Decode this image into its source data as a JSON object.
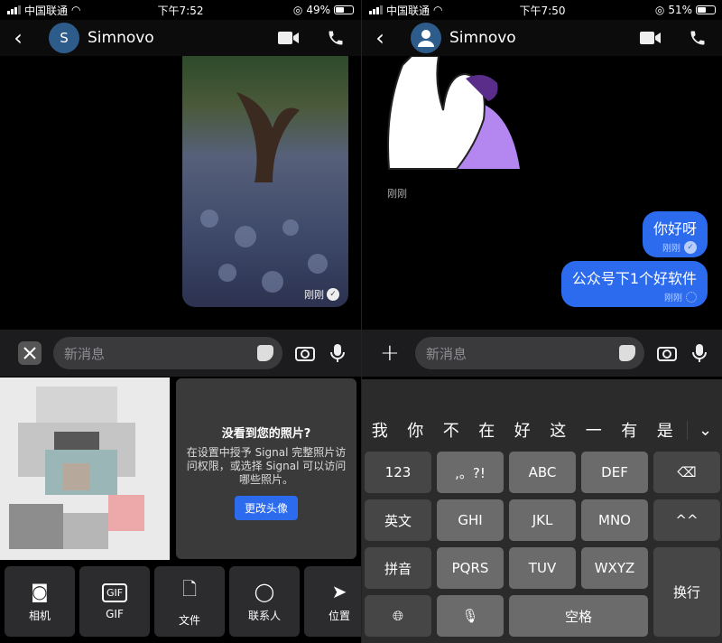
{
  "left": {
    "status": {
      "carrier": "中国联通",
      "time": "下午7:52",
      "battery": "49%",
      "battery_level": 0.49
    },
    "header": {
      "contact_name": "Simnovo",
      "avatar_initial": "S"
    },
    "message": {
      "timestamp": "刚刚"
    },
    "input": {
      "placeholder": "新消息"
    },
    "permission": {
      "title": "没看到您的照片?",
      "body": "在设置中授予 Signal 完整照片访问权限，或选择 Signal 可以访问哪些照片。",
      "button": "更改头像"
    },
    "attachments": [
      {
        "label": "相机",
        "icon": "camera-icon"
      },
      {
        "label": "GIF",
        "icon": "gif-icon"
      },
      {
        "label": "文件",
        "icon": "file-icon"
      },
      {
        "label": "联系人",
        "icon": "contact-icon"
      },
      {
        "label": "位置",
        "icon": "location-icon"
      }
    ]
  },
  "right": {
    "status": {
      "carrier": "中国联通",
      "time": "下午7:50",
      "battery": "51%",
      "battery_level": 0.51
    },
    "header": {
      "contact_name": "Simnovo"
    },
    "sticker_timestamp": "刚刚",
    "messages": [
      {
        "text": "你好呀",
        "time": "刚刚",
        "status": "delivered"
      },
      {
        "text": "公众号下1个好软件",
        "time": "刚刚",
        "status": "sending"
      }
    ],
    "input": {
      "placeholder": "新消息"
    },
    "keyboard": {
      "candidates": [
        "我",
        "你",
        "不",
        "在",
        "好",
        "这",
        "一",
        "有",
        "是"
      ],
      "keys": {
        "k123": "123",
        "punct": ",。?!",
        "abc": "ABC",
        "def": "DEF",
        "en": "英文",
        "ghi": "GHI",
        "jkl": "JKL",
        "mno": "MNO",
        "face": "^^",
        "pinyin": "拼音",
        "pqrs": "PQRS",
        "tuv": "TUV",
        "wxyz": "WXYZ",
        "enter": "换行",
        "space": "空格"
      }
    }
  }
}
